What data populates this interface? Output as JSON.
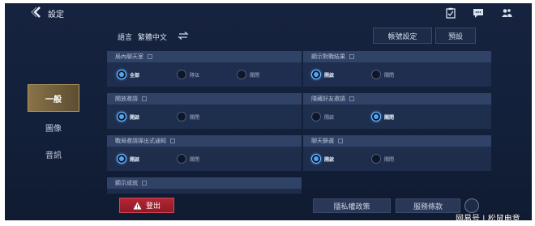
{
  "header": {
    "title": "設定"
  },
  "icons": {
    "back": "back-chevron-icon",
    "clipboard": "clipboard-icon",
    "chat": "chat-icon",
    "friends": "friends-icon"
  },
  "sidebar": {
    "items": [
      {
        "label": "一般",
        "active": true
      },
      {
        "label": "圖像",
        "active": false
      },
      {
        "label": "音訊",
        "active": false
      }
    ]
  },
  "language": {
    "label": "語言",
    "value": "繁體中文"
  },
  "buttons": {
    "account": "帳號設定",
    "default": "預設",
    "logout": "登出",
    "privacy": "隱私權政策",
    "terms": "服務條款"
  },
  "sections": [
    {
      "title": "局內聊天室",
      "options": [
        "全部",
        "隊伍",
        "關閉"
      ],
      "selected": 0
    },
    {
      "title": "顯示對戰結果",
      "options": [
        "開啟",
        "關閉"
      ],
      "selected": 0
    },
    {
      "title": "開放邀請",
      "options": [
        "開啟",
        "關閉"
      ],
      "selected": 0
    },
    {
      "title": "隱藏好友邀請",
      "options": [
        "開啟",
        "關閉"
      ],
      "selected": 1
    },
    {
      "title": "戰局邀請彈出式通知",
      "options": [
        "開啟",
        "關閉"
      ],
      "selected": 0
    },
    {
      "title": "聊天篩選",
      "options": [
        "開啟",
        "關閉"
      ],
      "selected": 0
    },
    {
      "title": "顯示成就",
      "options": [],
      "selected": -1
    }
  ],
  "watermark": "网易号 | 松鼠电竞",
  "colors": {
    "accent": "#49a7ff",
    "active_tab": "#8a7448",
    "logout": "#b32633",
    "background": "#16233f"
  }
}
